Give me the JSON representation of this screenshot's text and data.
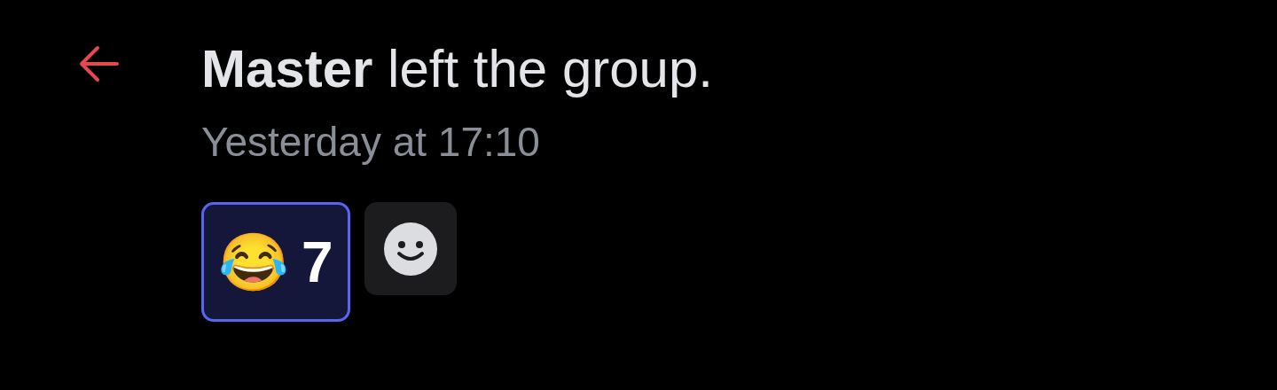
{
  "message": "**Master** left the group.",
  "timestamp": "Yesterday at 17:10",
  "reactions": [
    {
      "emoji": "😂",
      "count": "7",
      "selected": true
    }
  ]
}
